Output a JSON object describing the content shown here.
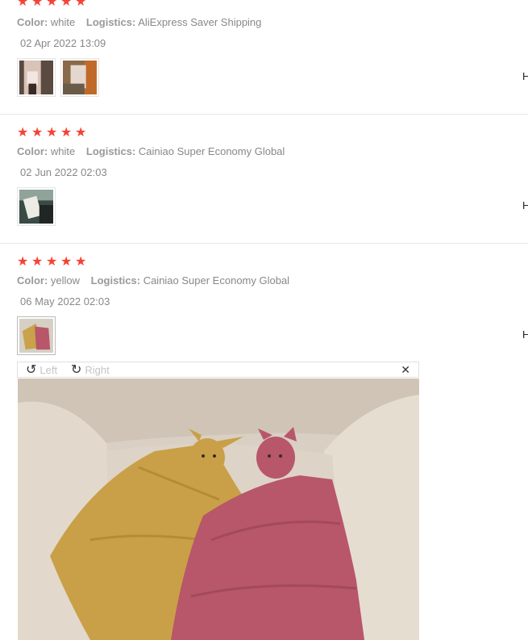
{
  "reviews": [
    {
      "rating": "★★★★★",
      "color_label": "Color:",
      "color_value": "white",
      "logistics_label": "Logistics:",
      "logistics_value": "AliExpress Saver Shipping",
      "date": "02 Apr 2022 13:09",
      "helpful": "H"
    },
    {
      "rating": "★★★★★",
      "color_label": "Color:",
      "color_value": "white",
      "logistics_label": "Logistics:",
      "logistics_value": "Cainiao Super Economy Global",
      "date": "02 Jun 2022 02:03",
      "helpful": "H"
    },
    {
      "rating": "★★★★★",
      "color_label": "Color:",
      "color_value": "yellow",
      "logistics_label": "Logistics:",
      "logistics_value": "Cainiao Super Economy Global",
      "date": "06 May 2022 02:03",
      "helpful": "H"
    }
  ],
  "viewer": {
    "rotate_left_label": "Left",
    "rotate_right_label": "Right",
    "close_glyph": "✕",
    "rotate_left_icon": "rotate-left-icon",
    "rotate_right_icon": "rotate-right-icon"
  },
  "colors": {
    "star": "#f44336",
    "muted_text": "#999999",
    "divider": "#e8e8e8"
  }
}
